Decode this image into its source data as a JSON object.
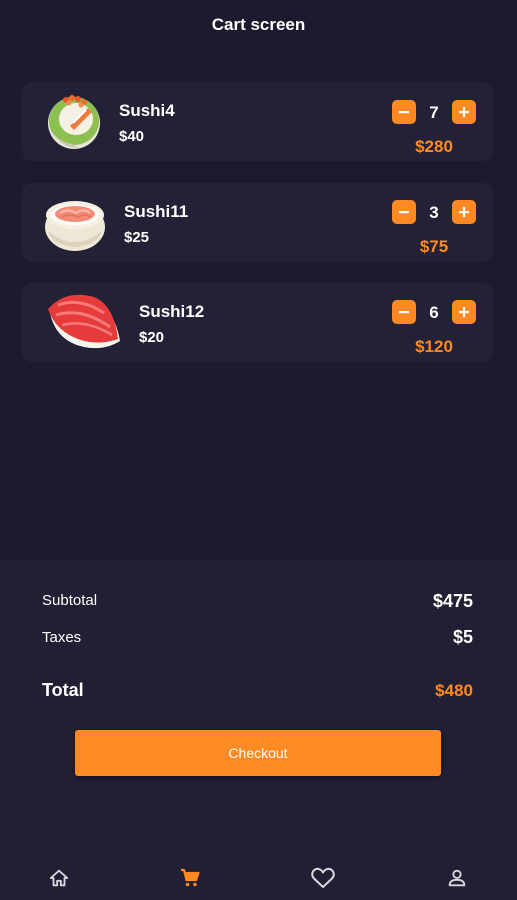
{
  "app_bar": {
    "title": "Cart screen"
  },
  "cart": {
    "items": [
      {
        "name": "Sushi4",
        "price": "$40",
        "quantity": "7",
        "line_total": "$280",
        "image_icon": "sushi-roll-icon"
      },
      {
        "name": "Sushi11",
        "price": "$25",
        "quantity": "3",
        "line_total": "$75",
        "image_icon": "salmon-bowl-icon"
      },
      {
        "name": "Sushi12",
        "price": "$20",
        "quantity": "6",
        "line_total": "$120",
        "image_icon": "tuna-nigiri-icon"
      }
    ]
  },
  "summary": {
    "subtotal_label": "Subtotal",
    "subtotal_value": "$475",
    "taxes_label": "Taxes",
    "taxes_value": "$5",
    "total_label": "Total",
    "total_value": "$480",
    "checkout_label": "Checkout"
  },
  "bottom_nav": {
    "items": [
      {
        "icon": "home-icon",
        "active": false
      },
      {
        "icon": "cart-icon",
        "active": true
      },
      {
        "icon": "heart-icon",
        "active": false
      },
      {
        "icon": "profile-icon",
        "active": false
      }
    ]
  },
  "colors": {
    "background": "#1b1a2e",
    "card": "#222135",
    "accent": "#ff8a24",
    "text": "#ffffff",
    "nav_inactive": "#d8d8e0"
  }
}
